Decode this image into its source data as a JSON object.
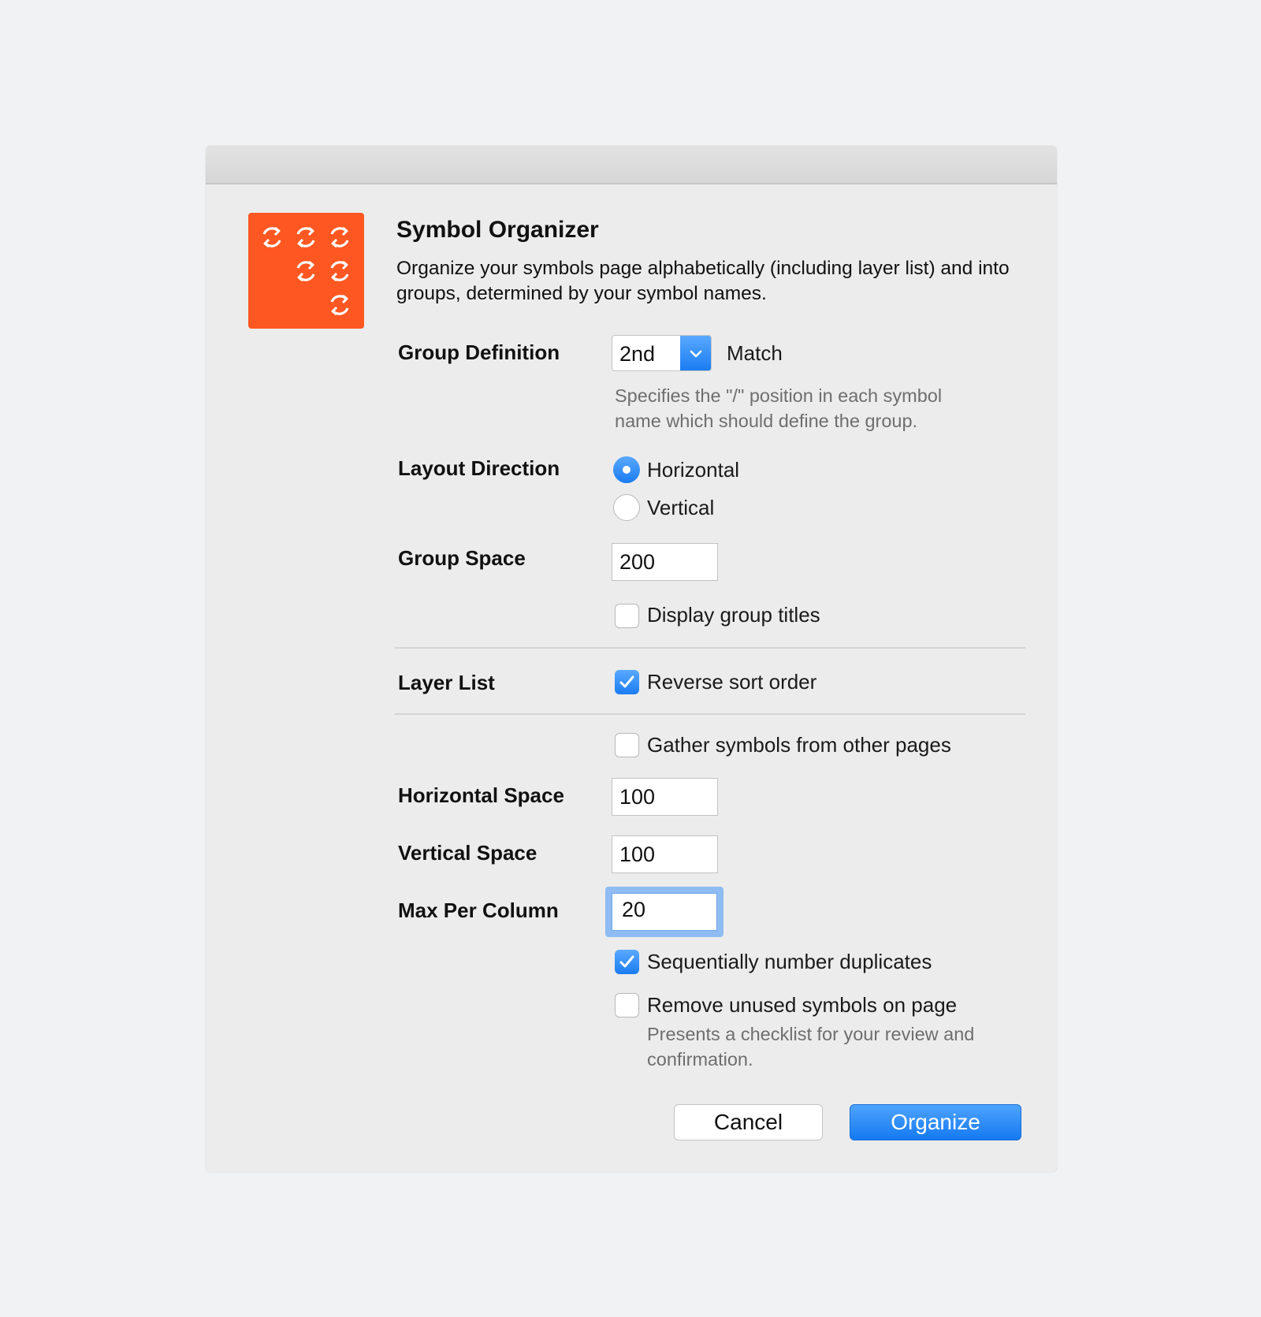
{
  "app": {
    "title": "Symbol Organizer",
    "description": "Organize your symbols page alphabetically (including layer list) and into groups, determined by your symbol names.",
    "icon": "refresh-grid-icon",
    "icon_color": "#ff5722"
  },
  "group_definition": {
    "label": "Group Definition",
    "selected": "2nd",
    "suffix": "Match",
    "hint": "Specifies the \"/\" position in each symbol name which should define the group."
  },
  "layout_direction": {
    "label": "Layout Direction",
    "options": [
      {
        "label": "Horizontal",
        "selected": true
      },
      {
        "label": "Vertical",
        "selected": false
      }
    ]
  },
  "group_space": {
    "label": "Group Space",
    "value": "200",
    "display_titles": {
      "label": "Display group titles",
      "checked": false
    }
  },
  "layer_list": {
    "label": "Layer List",
    "reverse": {
      "label": "Reverse sort order",
      "checked": true
    }
  },
  "gather": {
    "label": "Gather symbols from other pages",
    "checked": false
  },
  "horizontal_space": {
    "label": "Horizontal Space",
    "value": "100"
  },
  "vertical_space": {
    "label": "Vertical Space",
    "value": "100"
  },
  "max_per_column": {
    "label": "Max Per Column",
    "value": "20"
  },
  "sequential": {
    "label": "Sequentially number duplicates",
    "checked": true
  },
  "remove_unused": {
    "label": "Remove unused symbols on page",
    "checked": false,
    "hint": "Presents a checklist for your review and confirmation."
  },
  "buttons": {
    "cancel": "Cancel",
    "primary": "Organize"
  },
  "colors": {
    "accent": "#1a7cf2",
    "background": "#ececec"
  }
}
